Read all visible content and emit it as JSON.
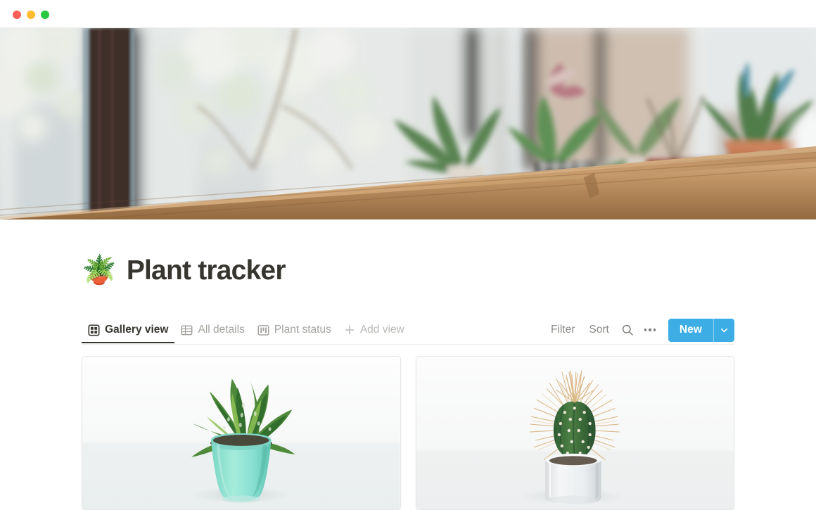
{
  "window": {
    "traffic_lights": [
      {
        "name": "close",
        "color": "#ff5f57"
      },
      {
        "name": "minimize",
        "color": "#febc2e"
      },
      {
        "name": "maximize",
        "color": "#28c840"
      }
    ]
  },
  "cover": {
    "alt": "Blurred photo of potted plants on a wooden window shelf",
    "description": "Indoor plants on a wooden shelf in front of a window with blurred white blossoms outside"
  },
  "header": {
    "emoji": "🪴",
    "emoji_name": "potted-plant",
    "title": "Plant tracker"
  },
  "views": {
    "tabs": [
      {
        "label": "Gallery view",
        "icon": "gallery-icon",
        "active": true
      },
      {
        "label": "All details",
        "icon": "table-icon",
        "active": false
      },
      {
        "label": "Plant status",
        "icon": "board-icon",
        "active": false
      }
    ],
    "add_view": {
      "label": "Add view",
      "icon": "plus-icon"
    }
  },
  "toolbar": {
    "filter_label": "Filter",
    "sort_label": "Sort",
    "search_icon": "search-icon",
    "more_icon": "ellipsis-icon",
    "new_label": "New",
    "new_caret_icon": "chevron-down-icon",
    "accent_color": "#3daee5"
  },
  "gallery": {
    "cards": [
      {
        "name": "succulent-card",
        "alt": "Green haworthia succulent in a mint green ceramic pot on a white background",
        "pot_color": "#8fe0d0",
        "plant_color": "#3f7f3a"
      },
      {
        "name": "cactus-card",
        "alt": "Small spiny barrel cactus in a white cylindrical pot on a white background",
        "pot_color": "#f2f3f4",
        "plant_color": "#3c6b44"
      }
    ]
  }
}
